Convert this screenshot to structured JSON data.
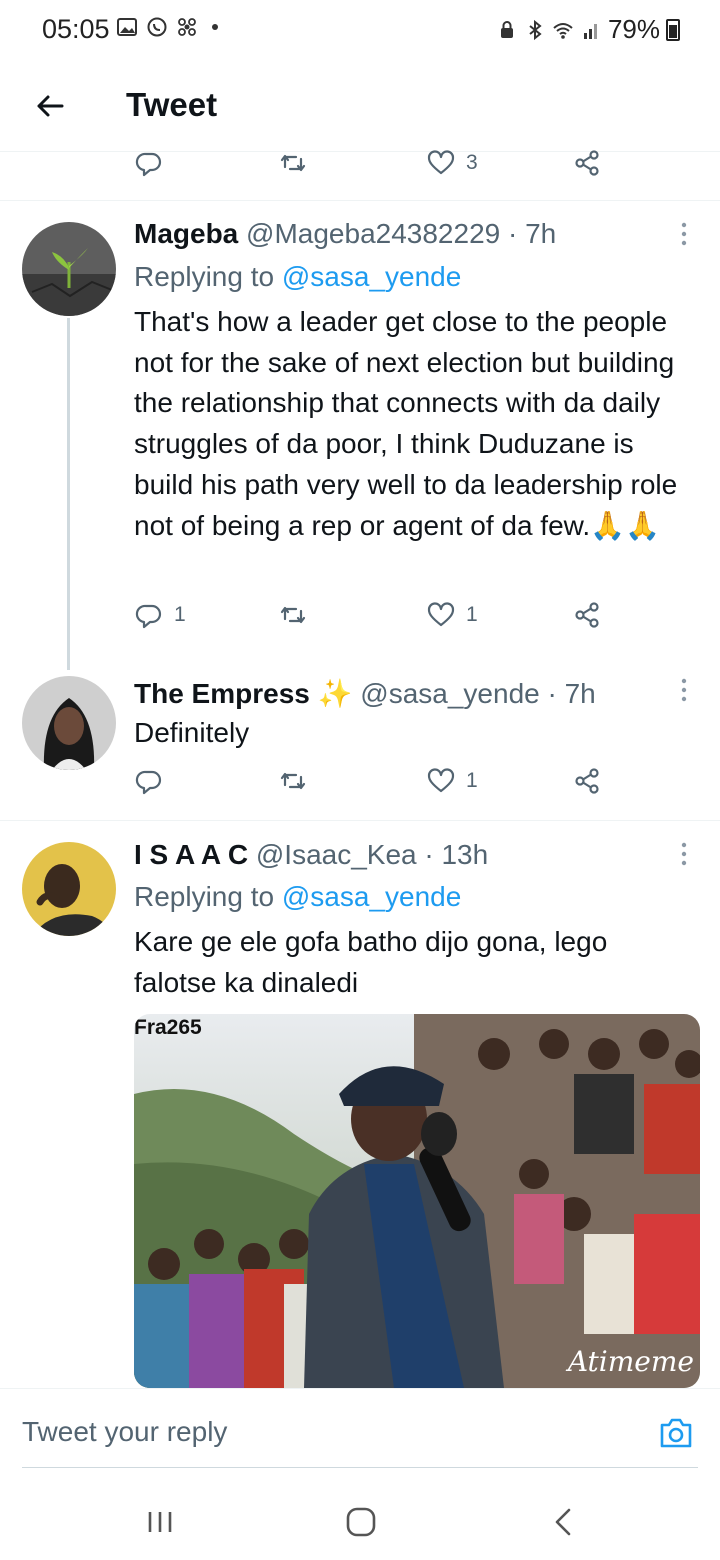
{
  "status_bar": {
    "time": "05:05",
    "battery": "79%",
    "left_icons": [
      "image-icon",
      "whatsapp-icon",
      "fan-icon"
    ],
    "right_icons": [
      "lock-icon",
      "bluetooth-icon",
      "wifi-icon",
      "signal-icon"
    ]
  },
  "header": {
    "title": "Tweet"
  },
  "top_actions": {
    "reply_count": "",
    "retweet_count": "",
    "like_count": "3"
  },
  "tweets": [
    {
      "name": "Mageba",
      "handle": "@Mageba24382229 · 7h",
      "replying_label": "Replying to",
      "replying_to": "@sasa_yende",
      "text": "That's how a  leader  get close to the people not for the sake of next election but building the relationship that connects with da daily struggles of da poor, I think Duduzane is build his path very well to da leadership role not of being a rep or agent of da few.🙏🙏",
      "reply_count": "1",
      "retweet_count": "",
      "like_count": "1"
    },
    {
      "name": "The Empress ✨",
      "handle": "@sasa_yende · 7h",
      "text": "Definitely",
      "reply_count": "",
      "retweet_count": "",
      "like_count": "1"
    },
    {
      "name": "I S A A C",
      "handle": "@Isaac_Kea · 13h",
      "replying_label": "Replying to",
      "replying_to": "@sasa_yende",
      "text": "Kare ge ele gofa batho dijo gona, lego falotse ka dinaledi",
      "media": {
        "watermark_top": "Fra265",
        "watermark_bottom": "Atimeme"
      }
    }
  ],
  "reply_bar": {
    "placeholder": "Tweet your reply"
  },
  "colors": {
    "accent": "#1d9bf0",
    "secondary_text": "#536471",
    "divider": "#eff3f4"
  }
}
